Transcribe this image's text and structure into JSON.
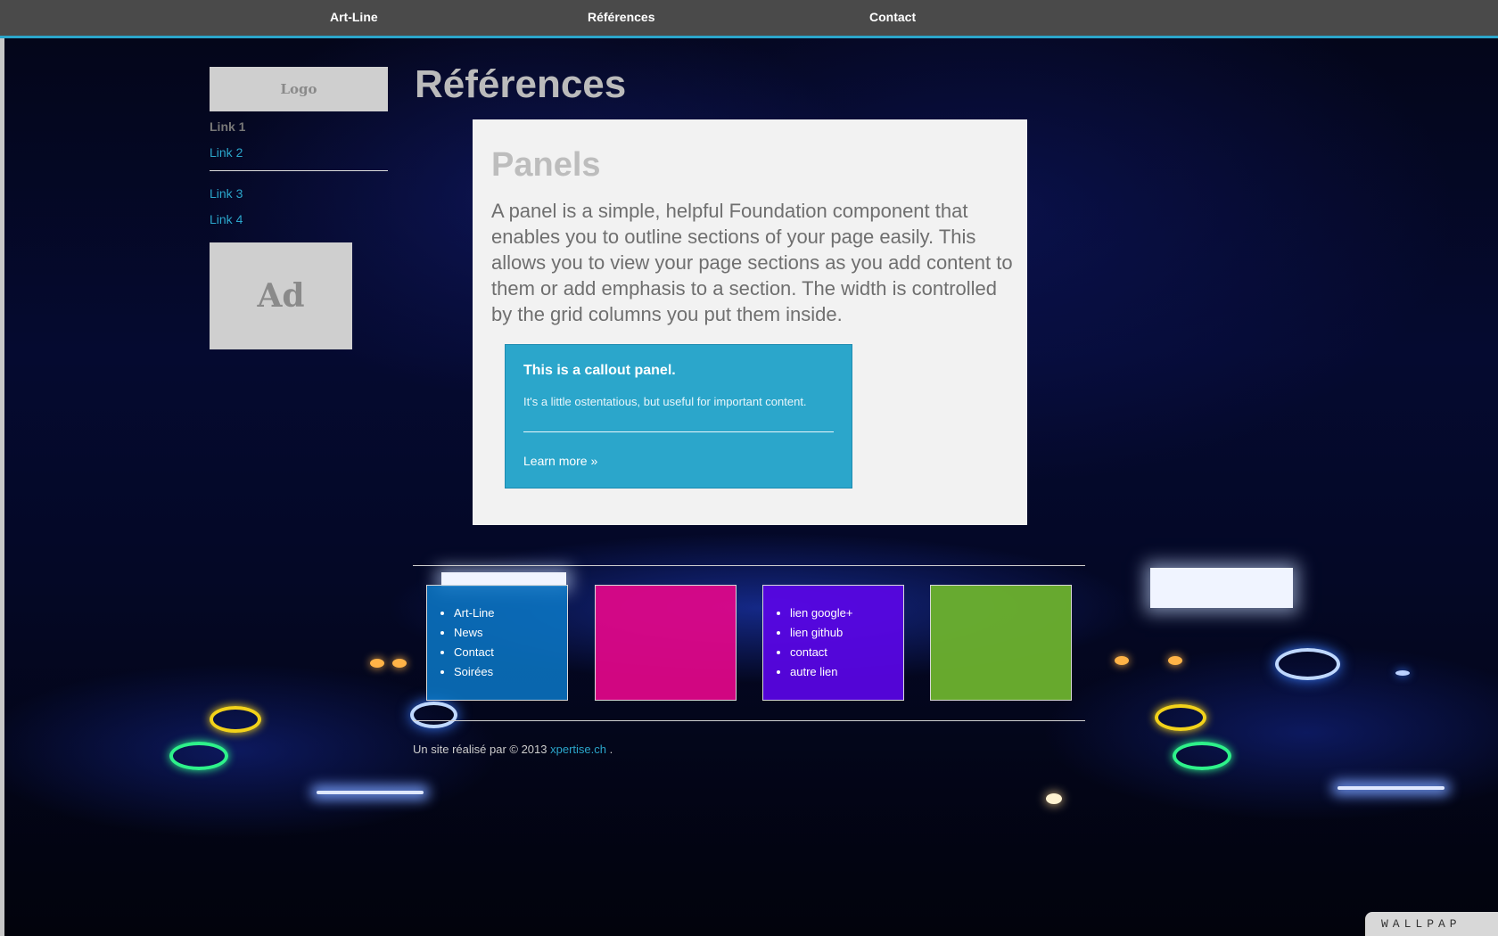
{
  "nav": {
    "items": [
      "Art-Line",
      "Références",
      "Contact"
    ]
  },
  "sidebar": {
    "logo_text": "Logo",
    "links": [
      "Link 1",
      "Link 2",
      "Link 3",
      "Link 4"
    ],
    "ad_text": "Ad"
  },
  "main": {
    "title": "Références",
    "panel": {
      "heading": "Panels",
      "text": "A panel is a simple, helpful Foundation component that enables you to outline sections of your page easily. This allows you to view your page sections as you add content to them or add emphasis to a section. The width is controlled by the grid columns you put them inside.",
      "callout": {
        "title": "This is a callout panel.",
        "text": "It's a little ostentatious, but useful for important content.",
        "link": "Learn more »"
      }
    }
  },
  "footer": {
    "tiles": [
      {
        "color": "#0a78c8",
        "items": [
          "Art-Line",
          "News",
          "Contact",
          "Soirées"
        ]
      },
      {
        "color": "#e3068a",
        "items": []
      },
      {
        "color": "#5a05e6",
        "items": [
          "lien google+",
          "lien github",
          "contact",
          "autre lien"
        ]
      },
      {
        "color": "#6db22e",
        "items": []
      }
    ],
    "credit_prefix": "Un site réalisé par © 2013",
    "credit_link": "xpertise.ch",
    "credit_suffix": "."
  },
  "watermark": "WALLPAP",
  "colors": {
    "accent": "#2ba6cb",
    "nav_bg": "#4a4a4a",
    "panel_bg": "#f2f2f2"
  }
}
